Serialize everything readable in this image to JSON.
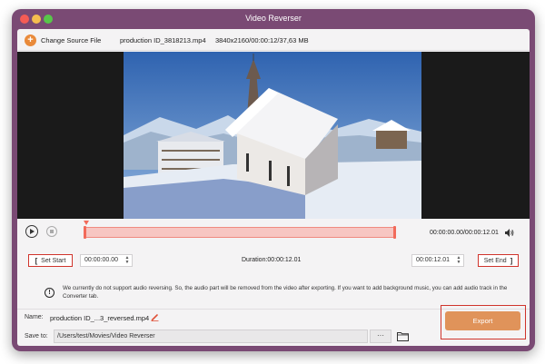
{
  "window": {
    "title": "Video Reverser"
  },
  "toolbar": {
    "change_source_label": "Change Source File",
    "file_name": "production ID_3818213.mp4",
    "file_info": "3840x2160/00:00:12/37,63 MB"
  },
  "player": {
    "time_readout": "00:00:00.00/00:00:12.01",
    "trim_start_fraction": 0.0,
    "trim_end_fraction": 1.0
  },
  "trim": {
    "set_start_label": "Set Start",
    "set_end_label": "Set End",
    "start_value": "00:00:00.00",
    "end_value": "00:00:12.01",
    "duration": "Duration:00:00:12.01"
  },
  "notice": {
    "text": "We currently do not support audio reversing. So, the audio part will be removed from the video after exporting. If you want to add background music, you can add audio track in the Converter tab."
  },
  "output": {
    "name_label": "Name:",
    "name_value": "production ID_...3_reversed.mp4",
    "save_label": "Save to:",
    "save_path": "/Users/test/Movies/Video Reverser",
    "browse_label": "···",
    "export_label": "Export"
  },
  "colors": {
    "accent": "#e0935a",
    "frame_bg": "#7a4a74",
    "highlight": "#d0342c",
    "timeline_fill": "#f7c6c2"
  }
}
